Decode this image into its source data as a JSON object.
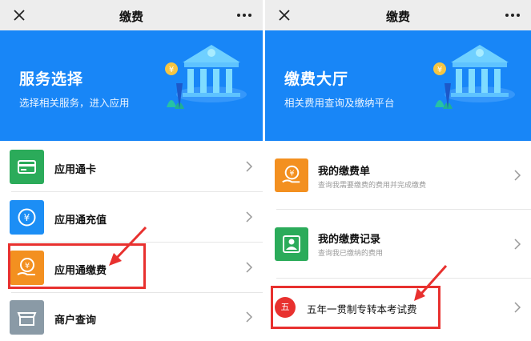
{
  "left": {
    "nav_title": "缴费",
    "hero_title": "服务选择",
    "hero_subtitle": "选择相关服务，进入应用",
    "items": [
      {
        "label": "应用通卡",
        "icon": "card-icon",
        "color": "#2bab5a"
      },
      {
        "label": "应用通充值",
        "icon": "yen-coin-icon",
        "color": "#1c8ef5"
      },
      {
        "label": "应用通缴费",
        "icon": "yen-hand-icon",
        "color": "#f39020"
      },
      {
        "label": "商户查询",
        "icon": "store-icon",
        "color": "#8a9aa6"
      }
    ]
  },
  "right": {
    "nav_title": "缴费",
    "hero_title": "缴费大厅",
    "hero_subtitle": "相关费用查询及缴纳平台",
    "items": [
      {
        "title": "我的缴费单",
        "subtitle": "查询我需要缴费的费用并完成缴费",
        "icon": "yen-hand-icon",
        "color": "#f39020"
      },
      {
        "title": "我的缴费记录",
        "subtitle": "查询我已缴纳的费用",
        "icon": "user-icon",
        "color": "#2bab5a"
      },
      {
        "badge": "五",
        "title": "五年一贯制专转本考试费",
        "color": "#e8312f"
      }
    ]
  },
  "colors": {
    "accent": "#1886f7",
    "highlight": "#e8312f"
  }
}
